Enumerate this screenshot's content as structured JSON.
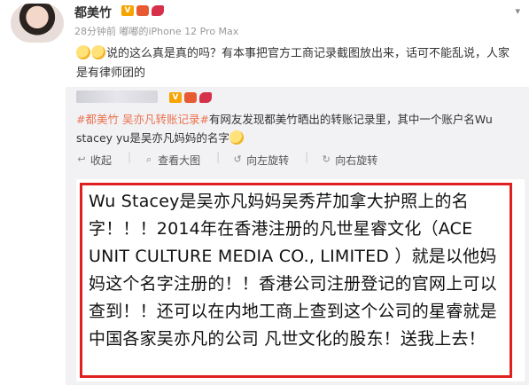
{
  "post": {
    "author": "都美竹",
    "vip_badge": "V",
    "meta": "28分钟前 嘟嘟的iPhone 12 Pro Max",
    "dropdown": "▾",
    "comment": "说的这么真是真的吗？有本事把官方工商记录截图放出来，话可不能乱说，人家是有律师团的"
  },
  "repost": {
    "vip_badge": "V",
    "tag": "#都美竹 吴亦凡转账记录#",
    "text": "有网友发现都美竹晒出的转账记录里，其中一个账户名Wu stacey yu是吴亦凡妈妈的名字",
    "actions": [
      {
        "label": "收起",
        "icon": "collapse-icon"
      },
      {
        "label": "查看大图",
        "icon": "zoom-icon"
      },
      {
        "label": "向左旋转",
        "icon": "rotate-left-icon"
      },
      {
        "label": "向右旋转",
        "icon": "rotate-right-icon"
      }
    ],
    "image_text": "Wu Stacey是吴亦凡妈妈吴秀芹加拿大护照上的名字！！！2014年在香港注册的凡世星睿文化（ACE UNIT CULTURE MEDIA CO., LIMITED ）就是以他妈妈这个名字注册的！！香港公司注册登记的官网上可以查到！！还可以在内地工商上查到这个公司的星睿就是中国各家吴亦凡的公司 凡世文化的股东！送我上去！"
  },
  "colors": {
    "accent": "#eb7350",
    "highlight_border": "#e02020"
  }
}
